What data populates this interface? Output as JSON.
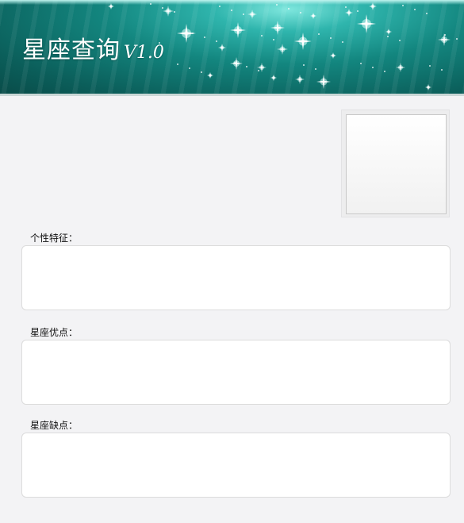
{
  "header": {
    "title": "星座查询",
    "version": "V1.0"
  },
  "photo": {
    "icon": "constellation-image-placeholder"
  },
  "sections": [
    {
      "label": "个性特征：",
      "value": ""
    },
    {
      "label": "星座优点：",
      "value": ""
    },
    {
      "label": "星座缺点：",
      "value": ""
    }
  ],
  "colors": {
    "banner": "#13867f",
    "background": "#f3f3f5"
  }
}
